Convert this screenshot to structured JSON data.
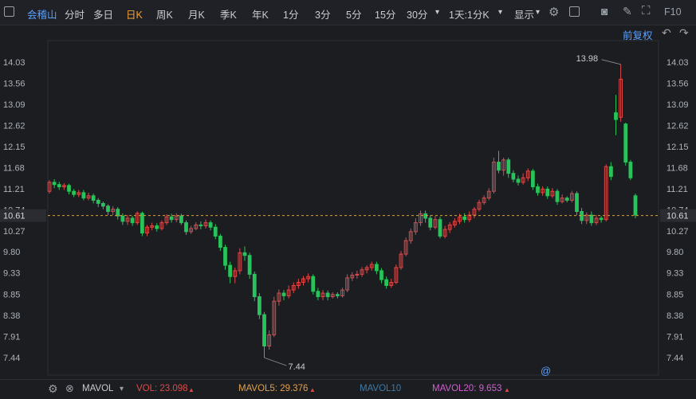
{
  "toolbar": {
    "stock_name": "会稽山",
    "tabs": [
      "分时",
      "多日",
      "日K",
      "周K",
      "月K",
      "季K",
      "年K",
      "1分",
      "3分",
      "5分",
      "15分",
      "30分"
    ],
    "active_tab": "日K",
    "period_select": "1天:1分K",
    "display_label": "显示",
    "right_label": "F10"
  },
  "adjust_label": "前复权",
  "status_bar": {
    "indicator": "MAVOL",
    "vol_label": "VOL: 23.098",
    "mavol5_label": "MAVOL5: 29.376",
    "mavol10_label": "MAVOL10",
    "mavol20_label": "MAVOL20: 9.653"
  },
  "colors": {
    "up": "#e04848",
    "down": "#28c35a",
    "bg": "#1b1d21",
    "accent": "#5aa0ff",
    "active": "#f0a33a"
  },
  "chart_data": {
    "type": "candlestick",
    "y_ticks": [
      "14.03",
      "13.56",
      "13.09",
      "12.62",
      "12.15",
      "11.68",
      "11.21",
      "10.74",
      "10.27",
      "9.80",
      "9.33",
      "8.85",
      "8.38",
      "7.91",
      "7.44"
    ],
    "ylim": [
      7.2,
      14.4
    ],
    "current_price": "10.61",
    "current_price_value": 10.61,
    "high_label": "13.98",
    "high_value": 13.98,
    "low_label": "7.44",
    "low_value": 7.44,
    "candles": [
      [
        11.15,
        11.35,
        11.1,
        11.4
      ],
      [
        11.35,
        11.3,
        11.22,
        11.42
      ],
      [
        11.3,
        11.25,
        11.18,
        11.36
      ],
      [
        11.25,
        11.28,
        11.18,
        11.33
      ],
      [
        11.28,
        11.15,
        11.08,
        11.32
      ],
      [
        11.15,
        11.08,
        11.02,
        11.2
      ],
      [
        11.08,
        11.12,
        11.02,
        11.18
      ],
      [
        11.12,
        11.0,
        10.95,
        11.18
      ],
      [
        11.0,
        11.05,
        10.95,
        11.12
      ],
      [
        11.05,
        10.95,
        10.88,
        11.1
      ],
      [
        10.95,
        10.88,
        10.8,
        11.0
      ],
      [
        10.88,
        10.82,
        10.75,
        10.92
      ],
      [
        10.82,
        10.7,
        10.62,
        10.86
      ],
      [
        10.7,
        10.75,
        10.62,
        10.82
      ],
      [
        10.75,
        10.6,
        10.52,
        10.8
      ],
      [
        10.6,
        10.48,
        10.4,
        10.66
      ],
      [
        10.48,
        10.55,
        10.4,
        10.62
      ],
      [
        10.55,
        10.45,
        10.38,
        10.6
      ],
      [
        10.45,
        10.66,
        10.4,
        10.7
      ],
      [
        10.66,
        10.22,
        10.15,
        10.7
      ],
      [
        10.22,
        10.35,
        10.15,
        10.4
      ],
      [
        10.35,
        10.38,
        10.28,
        10.45
      ],
      [
        10.38,
        10.32,
        10.25,
        10.44
      ],
      [
        10.32,
        10.45,
        10.28,
        10.5
      ],
      [
        10.45,
        10.58,
        10.4,
        10.64
      ],
      [
        10.58,
        10.52,
        10.45,
        10.65
      ],
      [
        10.52,
        10.6,
        10.46,
        10.66
      ],
      [
        10.6,
        10.45,
        10.4,
        10.65
      ],
      [
        10.45,
        10.25,
        10.18,
        10.5
      ],
      [
        10.25,
        10.32,
        10.2,
        10.38
      ],
      [
        10.32,
        10.4,
        10.28,
        10.46
      ],
      [
        10.4,
        10.38,
        10.3,
        10.48
      ],
      [
        10.38,
        10.45,
        10.32,
        10.52
      ],
      [
        10.45,
        10.35,
        10.28,
        10.5
      ],
      [
        10.35,
        10.15,
        10.08,
        10.42
      ],
      [
        10.15,
        9.9,
        9.82,
        10.2
      ],
      [
        9.9,
        9.5,
        9.4,
        9.96
      ],
      [
        9.5,
        9.25,
        9.1,
        9.58
      ],
      [
        9.25,
        9.38,
        9.1,
        9.45
      ],
      [
        9.38,
        9.78,
        9.3,
        9.88
      ],
      [
        9.78,
        9.72,
        9.6,
        9.92
      ],
      [
        9.72,
        9.3,
        9.2,
        9.78
      ],
      [
        9.3,
        8.8,
        8.7,
        9.36
      ],
      [
        8.8,
        8.4,
        8.3,
        8.88
      ],
      [
        8.4,
        7.7,
        7.44,
        8.46
      ],
      [
        7.7,
        7.95,
        7.62,
        8.05
      ],
      [
        7.95,
        8.7,
        7.9,
        8.8
      ],
      [
        8.7,
        8.88,
        8.6,
        8.96
      ],
      [
        8.88,
        8.82,
        8.72,
        8.95
      ],
      [
        8.82,
        8.95,
        8.76,
        9.05
      ],
      [
        8.95,
        9.05,
        8.88,
        9.12
      ],
      [
        9.05,
        9.12,
        8.98,
        9.2
      ],
      [
        9.12,
        9.2,
        9.05,
        9.26
      ],
      [
        9.2,
        9.25,
        9.12,
        9.32
      ],
      [
        9.25,
        8.92,
        8.85,
        9.3
      ],
      [
        8.92,
        8.8,
        8.72,
        9.0
      ],
      [
        8.8,
        8.88,
        8.72,
        8.95
      ],
      [
        8.88,
        8.8,
        8.72,
        8.94
      ],
      [
        8.8,
        8.85,
        8.76,
        8.9
      ],
      [
        8.85,
        8.82,
        8.76,
        8.9
      ],
      [
        8.82,
        8.95,
        8.78,
        9.0
      ],
      [
        8.95,
        9.22,
        8.9,
        9.3
      ],
      [
        9.22,
        9.28,
        9.15,
        9.35
      ],
      [
        9.28,
        9.3,
        9.2,
        9.38
      ],
      [
        9.3,
        9.4,
        9.24,
        9.46
      ],
      [
        9.4,
        9.45,
        9.32,
        9.5
      ],
      [
        9.45,
        9.52,
        9.38,
        9.58
      ],
      [
        9.52,
        9.38,
        9.3,
        9.58
      ],
      [
        9.38,
        9.18,
        9.1,
        9.44
      ],
      [
        9.18,
        9.05,
        8.98,
        9.25
      ],
      [
        9.05,
        9.12,
        9.0,
        9.2
      ],
      [
        9.12,
        9.45,
        9.08,
        9.52
      ],
      [
        9.45,
        9.75,
        9.4,
        9.82
      ],
      [
        9.75,
        10.05,
        9.7,
        10.12
      ],
      [
        10.05,
        10.25,
        9.98,
        10.32
      ],
      [
        10.25,
        10.45,
        10.18,
        10.55
      ],
      [
        10.45,
        10.65,
        10.38,
        10.72
      ],
      [
        10.65,
        10.55,
        10.45,
        10.72
      ],
      [
        10.55,
        10.35,
        10.28,
        10.62
      ],
      [
        10.35,
        10.52,
        10.3,
        10.6
      ],
      [
        10.52,
        10.15,
        10.1,
        10.58
      ],
      [
        10.15,
        10.3,
        10.1,
        10.38
      ],
      [
        10.3,
        10.4,
        10.22,
        10.46
      ],
      [
        10.4,
        10.48,
        10.34,
        10.55
      ],
      [
        10.48,
        10.58,
        10.42,
        10.65
      ],
      [
        10.58,
        10.52,
        10.45,
        10.66
      ],
      [
        10.52,
        10.62,
        10.46,
        10.7
      ],
      [
        10.62,
        10.75,
        10.55,
        10.8
      ],
      [
        10.75,
        10.9,
        10.7,
        10.96
      ],
      [
        10.9,
        11.0,
        10.85,
        11.06
      ],
      [
        11.0,
        11.15,
        10.95,
        11.22
      ],
      [
        11.15,
        11.8,
        11.1,
        11.9
      ],
      [
        11.8,
        11.62,
        11.55,
        12.05
      ],
      [
        11.62,
        11.85,
        11.5,
        11.9
      ],
      [
        11.85,
        11.55,
        11.45,
        11.9
      ],
      [
        11.55,
        11.42,
        11.35,
        11.62
      ],
      [
        11.42,
        11.35,
        11.28,
        11.5
      ],
      [
        11.35,
        11.45,
        11.3,
        11.55
      ],
      [
        11.45,
        11.6,
        11.38,
        11.66
      ],
      [
        11.6,
        11.25,
        11.18,
        11.65
      ],
      [
        11.25,
        11.12,
        11.05,
        11.32
      ],
      [
        11.12,
        11.2,
        11.05,
        11.26
      ],
      [
        11.2,
        11.05,
        10.98,
        11.26
      ],
      [
        11.05,
        11.15,
        11.0,
        11.22
      ],
      [
        11.15,
        10.92,
        10.85,
        11.2
      ],
      [
        10.92,
        11.0,
        10.88,
        11.08
      ],
      [
        11.0,
        10.95,
        10.9,
        11.04
      ],
      [
        10.95,
        11.1,
        10.9,
        11.16
      ],
      [
        11.1,
        10.7,
        10.62,
        11.15
      ],
      [
        10.7,
        10.5,
        10.42,
        10.78
      ],
      [
        10.5,
        10.62,
        10.42,
        10.68
      ],
      [
        10.62,
        10.45,
        10.38,
        10.7
      ],
      [
        10.45,
        10.55,
        10.4,
        10.62
      ],
      [
        10.55,
        10.52,
        10.45,
        10.6
      ],
      [
        10.52,
        11.7,
        10.48,
        11.75
      ],
      [
        11.7,
        11.48,
        11.4,
        11.8
      ],
      [
        12.9,
        12.75,
        12.4,
        13.3
      ],
      [
        12.8,
        13.65,
        12.7,
        13.98
      ],
      [
        12.65,
        11.8,
        11.72,
        12.68
      ],
      [
        11.8,
        11.45,
        11.4,
        11.85
      ],
      [
        11.05,
        10.62,
        10.55,
        11.1
      ]
    ]
  }
}
